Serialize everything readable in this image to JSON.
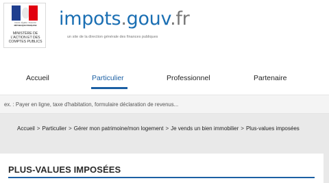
{
  "header": {
    "emblem": {
      "motto": "Liberté • Égalité • Fraternité",
      "republic": "RÉPUBLIQUE FRANÇAISE",
      "ministry": "MINISTÈRE DE L'ACTION ET DES COMPTES PUBLICS"
    },
    "logo": {
      "part1": "impots",
      "part2": ".",
      "part3": "gouv",
      "part4": ".fr"
    },
    "tagline": "un site de la direction générale des finances publiques"
  },
  "nav": {
    "items": [
      {
        "label": "Accueil",
        "active": false
      },
      {
        "label": "Particulier",
        "active": true
      },
      {
        "label": "Professionnel",
        "active": false
      },
      {
        "label": "Partenaire",
        "active": false
      }
    ]
  },
  "search": {
    "placeholder": "ex. : Payer en ligne, taxe d'habitation, formulaire déclaration de revenus..."
  },
  "breadcrumb": {
    "items": [
      "Accueil",
      "Particulier",
      "Gérer mon patrimoine/mon logement",
      "Je vends un bien immobilier",
      "Plus-values imposées"
    ],
    "separator": ">"
  },
  "page": {
    "title": "PLUS-VALUES IMPOSÉES"
  },
  "colors": {
    "accent": "#1b5fa3",
    "logo_blue": "#1b6fb3",
    "logo_grey": "#777777",
    "content_bg": "#e9e9e9"
  }
}
